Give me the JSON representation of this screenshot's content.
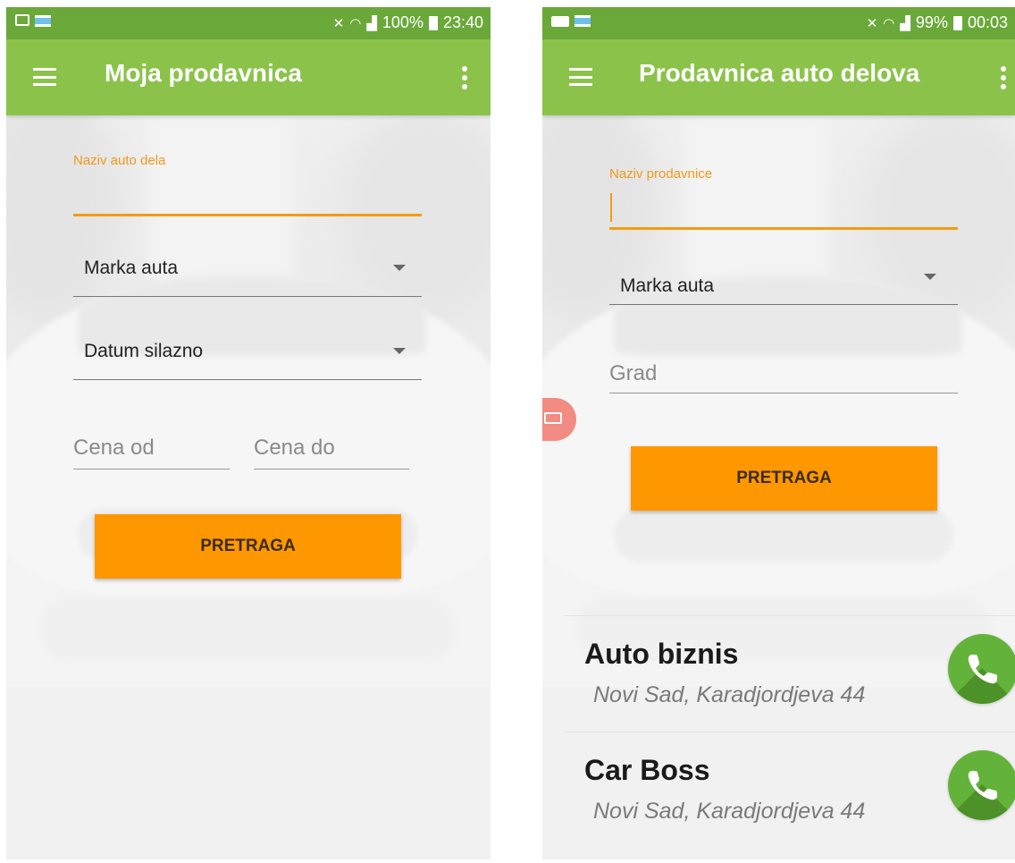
{
  "left_screen": {
    "status_bar": {
      "battery": "100%",
      "time": "23:40"
    },
    "app_bar": {
      "title": "Moja prodavnica"
    },
    "form": {
      "part_name_label": "Naziv auto dela",
      "part_name_value": "",
      "car_brand": "Marka auta",
      "sort_order": "Datum silazno",
      "price_from_placeholder": "Cena od",
      "price_to_placeholder": "Cena do",
      "search_button": "PRETRAGA"
    }
  },
  "right_screen": {
    "status_bar": {
      "battery": "99%",
      "time": "00:03"
    },
    "app_bar": {
      "title": "Prodavnica auto delova"
    },
    "form": {
      "store_name_label": "Naziv prodavnice",
      "store_name_value": "",
      "car_brand": "Marka auta",
      "city_placeholder": "Grad",
      "search_button": "PRETRAGA"
    },
    "results": [
      {
        "name": "Auto biznis",
        "address": "Novi Sad, Karadjordjeva 44",
        "action_icon": "phone-icon"
      },
      {
        "name": "Car Boss",
        "address": "Novi Sad, Karadjordjeva 44",
        "action_icon": "phone-icon"
      }
    ]
  },
  "colors": {
    "app_bar": "#8bc34a",
    "status_bar": "#6aa83a",
    "accent": "#ff9800",
    "call_button": "#63b33a"
  }
}
